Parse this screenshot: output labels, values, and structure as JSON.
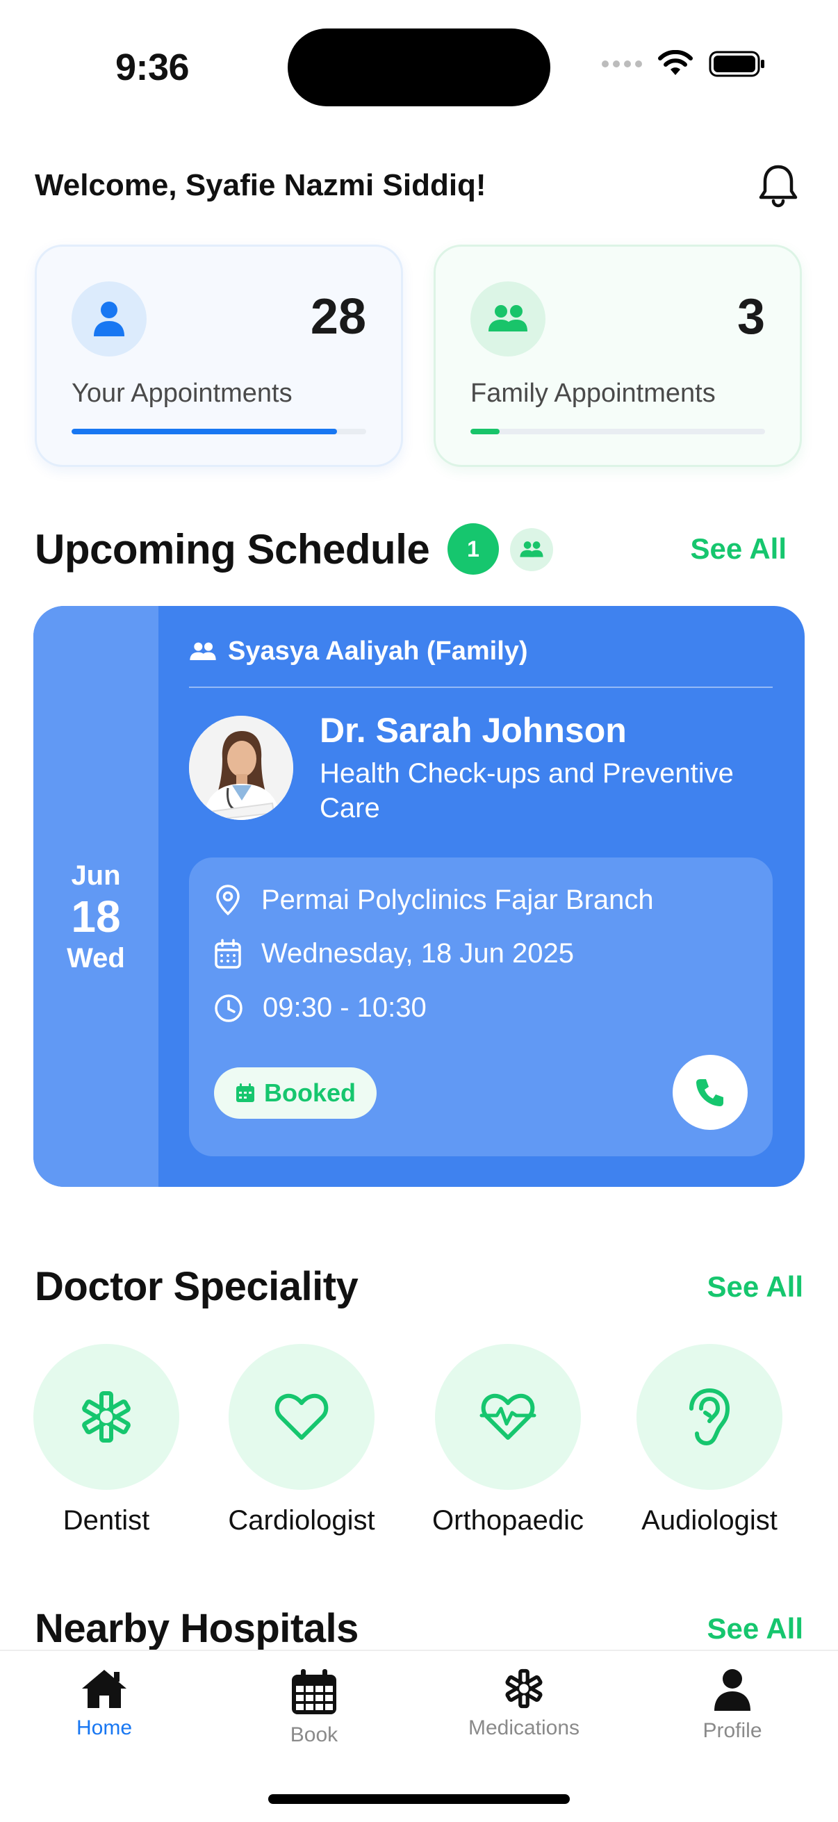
{
  "status_bar": {
    "time": "9:36"
  },
  "header": {
    "welcome": "Welcome, Syafie Nazmi Siddiq!"
  },
  "stats": [
    {
      "count": "28",
      "label": "Your Appointments",
      "progress_fraction": 0.9,
      "color": "#1877f2"
    },
    {
      "count": "3",
      "label": "Family Appointments",
      "progress_fraction": 0.1,
      "color": "#19c46a"
    }
  ],
  "upcoming": {
    "title": "Upcoming Schedule",
    "badge_count": "1",
    "see_all": "See All",
    "appointment": {
      "month": "Jun",
      "day": "18",
      "weekday": "Wed",
      "patient": "Syasya Aaliyah (Family)",
      "doctor": "Dr. Sarah Johnson",
      "specialty": "Health Check-ups and Preventive Care",
      "location": "Permai Polyclinics Fajar Branch",
      "date": "Wednesday, 18 Jun 2025",
      "time": "09:30 - 10:30",
      "status": "Booked"
    }
  },
  "speciality": {
    "title": "Doctor Speciality",
    "see_all": "See All",
    "items": [
      {
        "label": "Dentist",
        "icon": "medical-asterisk-icon"
      },
      {
        "label": "Cardiologist",
        "icon": "heart-icon"
      },
      {
        "label": "Orthopaedic",
        "icon": "heart-pulse-icon"
      },
      {
        "label": "Audiologist",
        "icon": "ear-icon"
      }
    ]
  },
  "nearby": {
    "title": "Nearby Hospitals",
    "see_all": "See All"
  },
  "tabs": [
    {
      "label": "Home",
      "icon": "home-icon",
      "active": true
    },
    {
      "label": "Book",
      "icon": "calendar-icon",
      "active": false
    },
    {
      "label": "Medications",
      "icon": "medical-asterisk-icon",
      "active": false
    },
    {
      "label": "Profile",
      "icon": "person-icon",
      "active": false
    }
  ],
  "colors": {
    "primary_blue": "#3f82ef",
    "accent_green": "#16c66e",
    "active_tab": "#1877f2"
  }
}
